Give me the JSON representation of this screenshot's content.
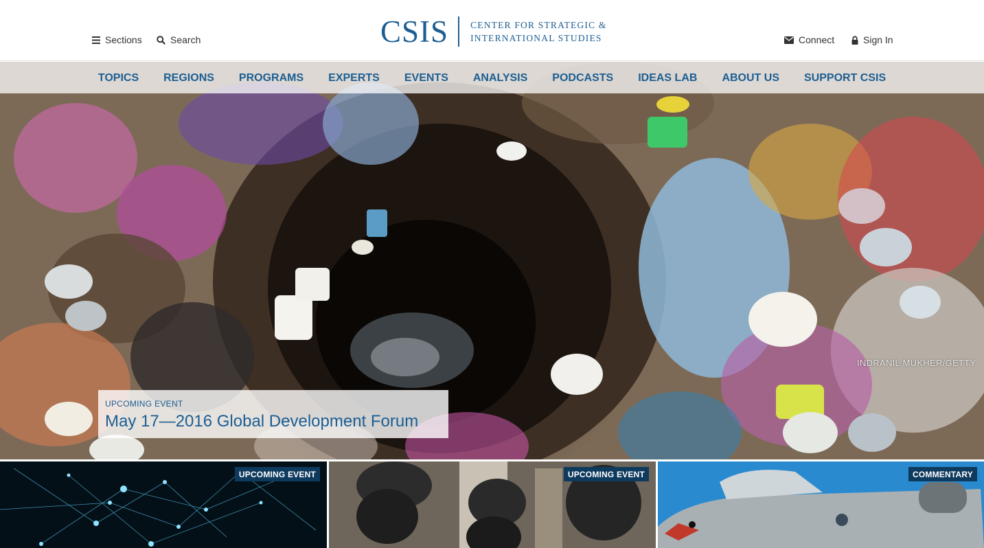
{
  "header": {
    "sections_label": "Sections",
    "search_label": "Search",
    "connect_label": "Connect",
    "signin_label": "Sign In",
    "logo": {
      "mark": "CSIS",
      "line1": "CENTER FOR STRATEGIC &",
      "line2": "INTERNATIONAL STUDIES"
    }
  },
  "nav": {
    "items": [
      {
        "label": "TOPICS"
      },
      {
        "label": "REGIONS"
      },
      {
        "label": "PROGRAMS"
      },
      {
        "label": "EXPERTS"
      },
      {
        "label": "EVENTS"
      },
      {
        "label": "ANALYSIS"
      },
      {
        "label": "PODCASTS"
      },
      {
        "label": "IDEAS LAB"
      },
      {
        "label": "ABOUT US"
      },
      {
        "label": "SUPPORT CSIS"
      }
    ]
  },
  "hero": {
    "photo_credit": "INDRANIL MUKHER/GETTY",
    "feature": {
      "kicker": "UPCOMING EVENT",
      "title": "May 17—2016 Global Development Forum"
    }
  },
  "cards": [
    {
      "badge": "UPCOMING EVENT"
    },
    {
      "badge": "UPCOMING EVENT"
    },
    {
      "badge": "COMMENTARY"
    }
  ],
  "colors": {
    "brand_blue": "#1b5e93",
    "badge_navy": "#0e3a5e"
  },
  "icons": [
    "hamburger-icon",
    "search-icon",
    "envelope-icon",
    "lock-icon"
  ]
}
